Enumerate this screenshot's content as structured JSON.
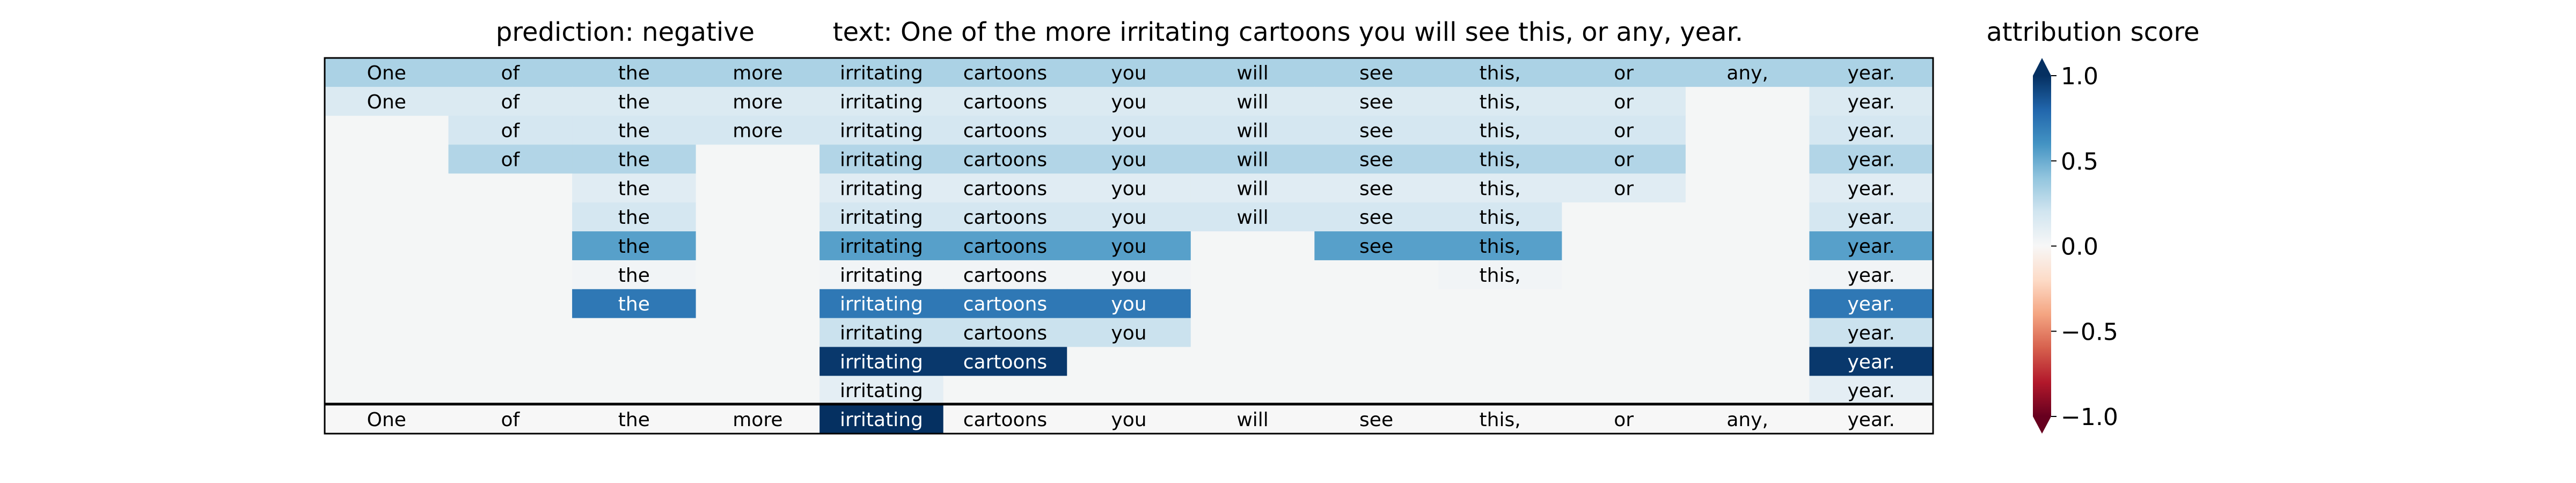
{
  "chart_data": {
    "type": "heatmap",
    "prediction_label": "prediction:  negative",
    "text_label": "text:  One of the more irritating cartoons you will see this, or any, year.",
    "colorbar_title": "attribution score",
    "colorbar": {
      "min": -1.0,
      "max": 1.0,
      "ticks": [
        1.0,
        0.5,
        0.0,
        -0.5,
        -1.0
      ],
      "tick_labels": [
        "1.0",
        "0.5",
        "0.0",
        "−0.5",
        "−1.0"
      ],
      "colormap": "RdBu",
      "extend": "both"
    },
    "tokens": [
      "One",
      "of",
      "the",
      "more",
      "irritating",
      "cartoons",
      "you",
      "will",
      "see",
      "this,",
      "or",
      "any,",
      "year."
    ],
    "rows": [
      [
        0.32,
        0.32,
        0.32,
        0.32,
        0.32,
        0.32,
        0.32,
        0.32,
        0.32,
        0.32,
        0.32,
        0.32,
        0.32
      ],
      [
        0.15,
        0.15,
        0.15,
        0.15,
        0.15,
        0.15,
        0.15,
        0.15,
        0.15,
        0.15,
        0.15,
        null,
        0.15
      ],
      [
        null,
        0.18,
        0.18,
        0.18,
        0.18,
        0.18,
        0.18,
        0.18,
        0.18,
        0.18,
        0.18,
        null,
        0.18
      ],
      [
        null,
        0.3,
        0.3,
        null,
        0.3,
        0.3,
        0.3,
        0.3,
        0.3,
        0.3,
        0.3,
        null,
        0.3
      ],
      [
        null,
        null,
        0.12,
        null,
        0.12,
        0.12,
        0.12,
        0.12,
        0.12,
        0.12,
        0.12,
        null,
        0.12
      ],
      [
        null,
        null,
        0.18,
        null,
        0.18,
        0.18,
        0.18,
        0.18,
        0.18,
        0.18,
        null,
        null,
        0.18
      ],
      [
        null,
        null,
        0.55,
        null,
        0.55,
        0.55,
        0.55,
        null,
        0.55,
        0.55,
        null,
        null,
        0.55
      ],
      [
        null,
        null,
        0.03,
        null,
        0.03,
        0.03,
        0.03,
        null,
        null,
        0.03,
        null,
        null,
        0.03
      ],
      [
        null,
        null,
        0.72,
        null,
        0.72,
        0.72,
        0.72,
        null,
        null,
        null,
        null,
        null,
        0.72
      ],
      [
        null,
        null,
        null,
        null,
        0.22,
        0.22,
        0.22,
        null,
        null,
        null,
        null,
        null,
        0.22
      ],
      [
        null,
        null,
        null,
        null,
        0.97,
        0.97,
        null,
        null,
        null,
        null,
        null,
        null,
        0.97
      ],
      [
        null,
        null,
        null,
        null,
        0.1,
        null,
        null,
        null,
        null,
        null,
        null,
        null,
        0.1
      ]
    ],
    "bottom_row": [
      0.0,
      0.0,
      0.0,
      0.0,
      1.0,
      0.0,
      0.0,
      0.0,
      0.0,
      0.0,
      0.0,
      0.0,
      0.0
    ],
    "empty_cell_color": "#f4f6f6"
  }
}
